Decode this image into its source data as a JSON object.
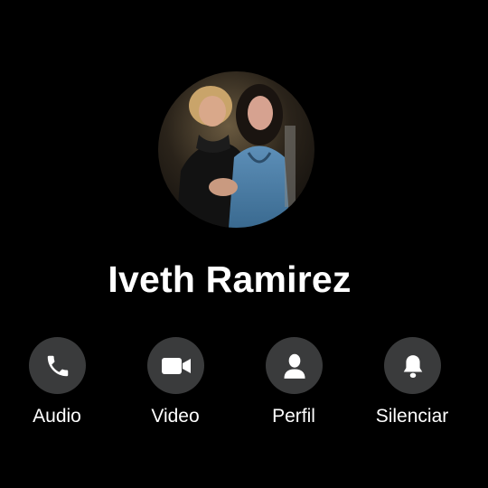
{
  "contact": {
    "name": "Iveth Ramirez"
  },
  "actions": [
    {
      "label": "Audio",
      "icon": "phone-icon"
    },
    {
      "label": "Video",
      "icon": "video-camera-icon"
    },
    {
      "label": "Perfil",
      "icon": "person-icon"
    },
    {
      "label": "Silenciar",
      "icon": "bell-icon"
    }
  ],
  "colors": {
    "background": "#000000",
    "button_circle": "#3a3b3c",
    "text": "#ffffff"
  }
}
